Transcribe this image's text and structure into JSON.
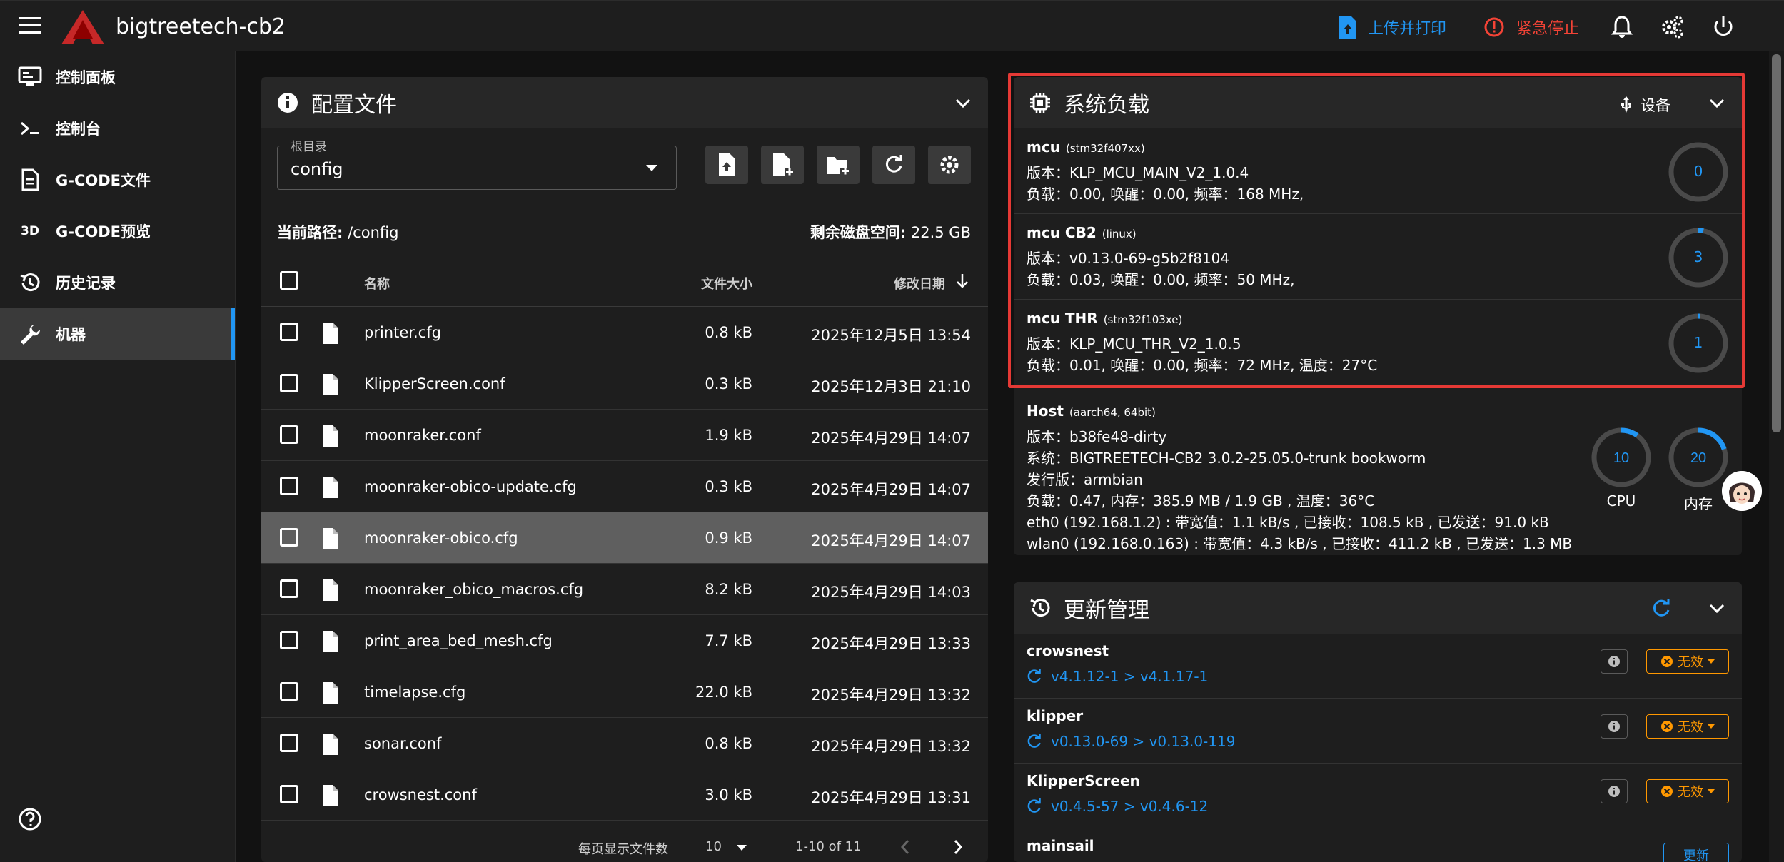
{
  "app": {
    "title": "bigtreetech-cb2"
  },
  "topbar": {
    "upload_label": "上传并打印",
    "stop_label": "紧急停止",
    "colors": {
      "accent": "#2196f3",
      "danger": "#f44336"
    }
  },
  "sidebar": {
    "items": [
      {
        "label": "控制面板",
        "icon": "dashboard-icon"
      },
      {
        "label": "控制台",
        "icon": "console-icon"
      },
      {
        "label": "G-CODE文件",
        "icon": "gcode-files-icon"
      },
      {
        "label": "G-CODE预览",
        "icon": "gcode-viewer-3d-icon"
      },
      {
        "label": "历史记录",
        "icon": "history-icon"
      },
      {
        "label": "机器",
        "icon": "wrench-icon",
        "active": true
      }
    ],
    "icon3d": "3D"
  },
  "files": {
    "title": "配置文件",
    "root_label": "根目录",
    "root_value": "config",
    "path_label": "当前路径:",
    "path_value": "/config",
    "disk_label": "剩余磁盘空间:",
    "disk_value": "22.5 GB",
    "columns": {
      "name": "名称",
      "size": "文件大小",
      "date": "修改日期"
    },
    "rows": [
      {
        "name": "printer.cfg",
        "size": "0.8 kB",
        "date": "2025年12月5日 13:54"
      },
      {
        "name": "KlipperScreen.conf",
        "size": "0.3 kB",
        "date": "2025年12月3日 21:10"
      },
      {
        "name": "moonraker.conf",
        "size": "1.9 kB",
        "date": "2025年4月29日 14:07"
      },
      {
        "name": "moonraker-obico-update.cfg",
        "size": "0.3 kB",
        "date": "2025年4月29日 14:07"
      },
      {
        "name": "moonraker-obico.cfg",
        "size": "0.9 kB",
        "date": "2025年4月29日 14:07",
        "highlight": true
      },
      {
        "name": "moonraker_obico_macros.cfg",
        "size": "8.2 kB",
        "date": "2025年4月29日 14:03"
      },
      {
        "name": "print_area_bed_mesh.cfg",
        "size": "7.7 kB",
        "date": "2025年4月29日 13:33"
      },
      {
        "name": "timelapse.cfg",
        "size": "22.0 kB",
        "date": "2025年4月29日 13:32"
      },
      {
        "name": "sonar.conf",
        "size": "0.8 kB",
        "date": "2025年4月29日 13:32"
      },
      {
        "name": "crowsnest.conf",
        "size": "3.0 kB",
        "date": "2025年4月29日 13:31"
      }
    ],
    "pager": {
      "per_page_label": "每页显示文件数",
      "per_page_value": "10",
      "range": "1-10 of 11"
    }
  },
  "sysload": {
    "title": "系统负载",
    "device_label": "设备",
    "mcus": [
      {
        "name": "mcu",
        "chip": "(stm32f407xx)",
        "version": "版本：KLP_MCU_MAIN_V2_1.0.4",
        "load": "负载：0.00, 唤醒：0.00, 频率：168 MHz,",
        "gauge": "0",
        "percent": 0
      },
      {
        "name": "mcu CB2",
        "chip": "(linux)",
        "version": "版本：v0.13.0-69-g5b2f8104",
        "load": "负载：0.03, 唤醒：0.00, 频率：50 MHz,",
        "gauge": "3",
        "percent": 3
      },
      {
        "name": "mcu THR",
        "chip": "(stm32f103xe)",
        "version": "版本：KLP_MCU_THR_V2_1.0.5",
        "load": "负载：0.01, 唤醒：0.00, 频率：72 MHz, 温度：27°C",
        "gauge": "1",
        "percent": 1
      }
    ],
    "host": {
      "name": "Host",
      "arch": "(aarch64, 64bit)",
      "lines": [
        "版本：b38fe48-dirty",
        "系统：BIGTREETECH-CB2 3.0.2-25.05.0-trunk bookworm",
        "发行版：armbian",
        "负载：0.47, 内存：385.9 MB / 1.9 GB , 温度：36°C",
        "eth0 (192.168.1.2) : 带宽值：1.1 kB/s , 已接收：108.5 kB , 已发送：91.0 kB",
        "wlan0 (192.168.0.163) : 带宽值：4.3 kB/s , 已接收：411.2 kB , 已发送：1.3 MB"
      ],
      "cpu": {
        "value": "10",
        "label": "CPU",
        "percent": 10
      },
      "mem": {
        "value": "20",
        "label": "内存",
        "percent": 20
      }
    }
  },
  "updates": {
    "title": "更新管理",
    "rows": [
      {
        "name": "crowsnest",
        "version": "v4.1.12-1 > v4.1.17-1",
        "status": "无效"
      },
      {
        "name": "klipper",
        "version": "v0.13.0-69 > v0.13.0-119",
        "status": "无效"
      },
      {
        "name": "KlipperScreen",
        "version": "v0.4.5-57 > v0.4.6-12",
        "status": "无效"
      },
      {
        "name": "mainsail",
        "action": "更新"
      }
    ]
  }
}
